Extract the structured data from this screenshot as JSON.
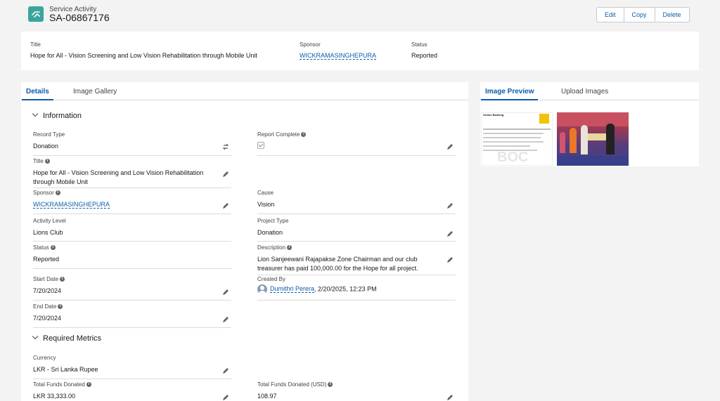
{
  "header": {
    "object_type": "Service Activity",
    "record_name": "SA-06867176",
    "buttons": [
      "Edit",
      "Copy",
      "Delete"
    ]
  },
  "highlights": {
    "title_label": "Title",
    "title_value": "Hope for All - Vision Screening and Low Vision Rehabilitation through Mobile Unit",
    "sponsor_label": "Sponsor",
    "sponsor_value": "WICKRAMASINGHEPURA",
    "status_label": "Status",
    "status_value": "Reported"
  },
  "left_tabs": [
    "Details",
    "Image Gallery"
  ],
  "right_tabs": [
    "Image Preview",
    "Upload Images"
  ],
  "sections": {
    "information": "Information",
    "required_metrics": "Required Metrics"
  },
  "fields": {
    "record_type": {
      "label": "Record Type",
      "value": "Donation"
    },
    "report_complete": {
      "label": "Report Complete",
      "checked": true
    },
    "title": {
      "label": "Title",
      "value": "Hope for All - Vision Screening and Low Vision Rehabilitation through Mobile Unit"
    },
    "sponsor": {
      "label": "Sponsor",
      "value": "WICKRAMASINGHEPURA"
    },
    "cause": {
      "label": "Cause",
      "value": "Vision"
    },
    "activity_level": {
      "label": "Activity Level",
      "value": "Lions Club"
    },
    "project_type": {
      "label": "Project Type",
      "value": "Donation"
    },
    "status": {
      "label": "Status",
      "value": "Reported"
    },
    "description": {
      "label": "Description",
      "value": "Lion Sanjeewani Rajapakse Zone Chairman and our club treasurer has paid 100,000.00 for the Hope for all project."
    },
    "start_date": {
      "label": "Start Date",
      "value": "7/20/2024"
    },
    "created_by": {
      "label": "Created By",
      "user": "Dumithri Perera",
      "date": ", 2/20/2025, 12:23 PM"
    },
    "end_date": {
      "label": "End Date",
      "value": "7/20/2024"
    },
    "currency": {
      "label": "Currency",
      "value": "LKR - Sri Lanka Rupee"
    },
    "total_funds": {
      "label": "Total Funds Donated",
      "value": "LKR 33,333.00"
    },
    "total_funds_usd": {
      "label": "Total Funds Donated (USD)",
      "value": "108.97"
    }
  },
  "receipt_image": {
    "heading": "Online Banking",
    "logo_text": "BOC"
  },
  "colors": {
    "accent": "#0b5cab",
    "object_icon": "#3ba59b",
    "page_bg": "#f3f3f3"
  }
}
